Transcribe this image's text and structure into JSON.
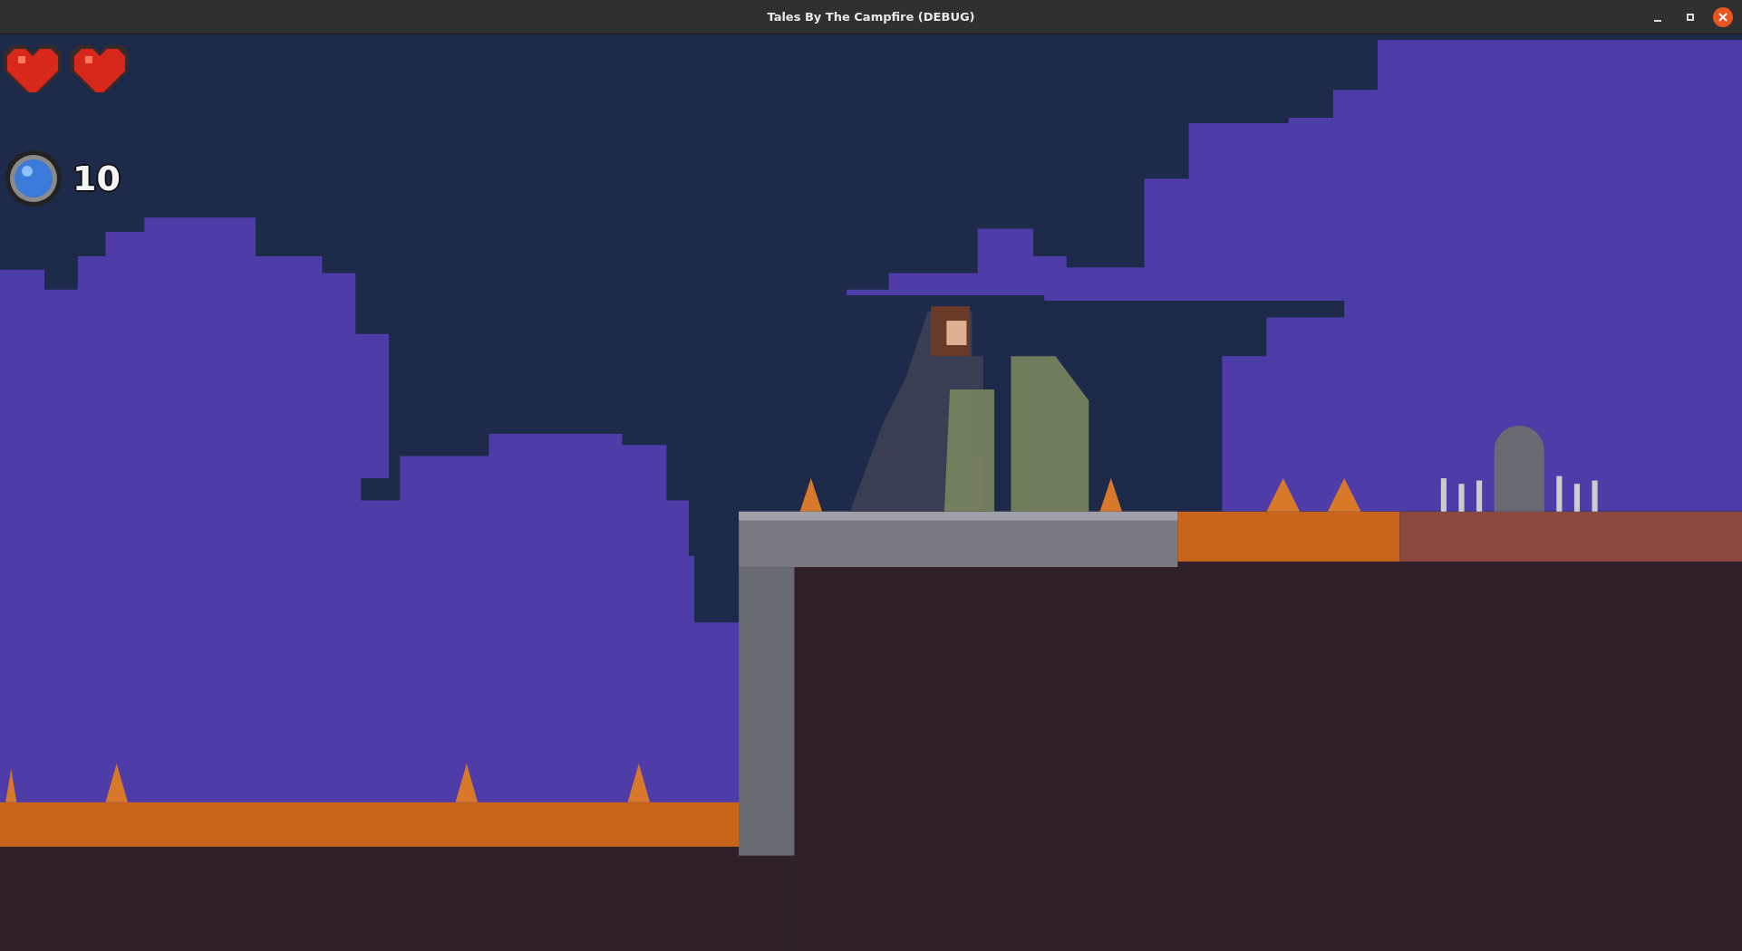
{
  "window": {
    "title": "Tales By The Campfire (DEBUG)"
  },
  "hud": {
    "hearts": [
      {
        "filled": true
      },
      {
        "filled": true
      }
    ],
    "orb_count": "10"
  }
}
